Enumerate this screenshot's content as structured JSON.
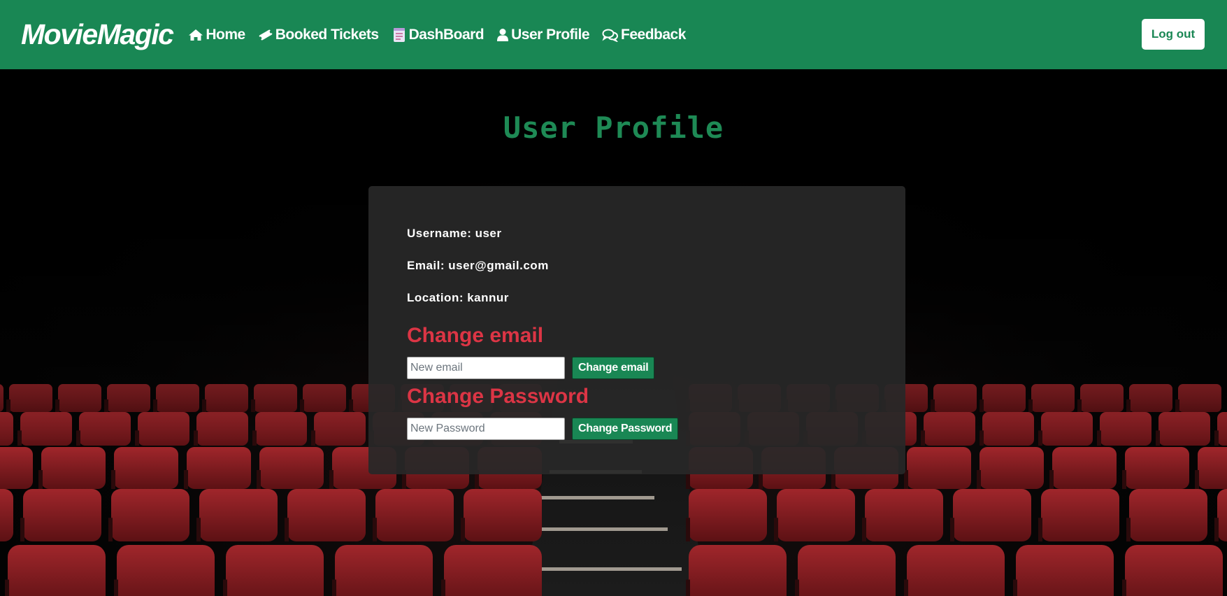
{
  "navbar": {
    "brand": "MovieMagic",
    "links": [
      {
        "label": "Home",
        "icon": "home-icon"
      },
      {
        "label": "Booked Tickets",
        "icon": "ticket-icon"
      },
      {
        "label": "DashBoard",
        "icon": "notepad-icon"
      },
      {
        "label": "User Profile",
        "icon": "user-icon"
      },
      {
        "label": "Feedback",
        "icon": "chat-bubbles-icon"
      }
    ],
    "logout_label": "Log out"
  },
  "page": {
    "title": "User Profile"
  },
  "profile": {
    "username": "Username: user",
    "email": "Email: user@gmail.com",
    "location": "Location: kannur"
  },
  "change_email": {
    "heading": "Change email",
    "placeholder": "New email",
    "button_label": "Change email"
  },
  "change_password": {
    "heading": "Change Password",
    "placeholder": "New Password",
    "button_label": "Change Password"
  },
  "colors": {
    "brand_green": "#198754",
    "danger_red": "#dc3545",
    "card_bg": "#282828"
  }
}
